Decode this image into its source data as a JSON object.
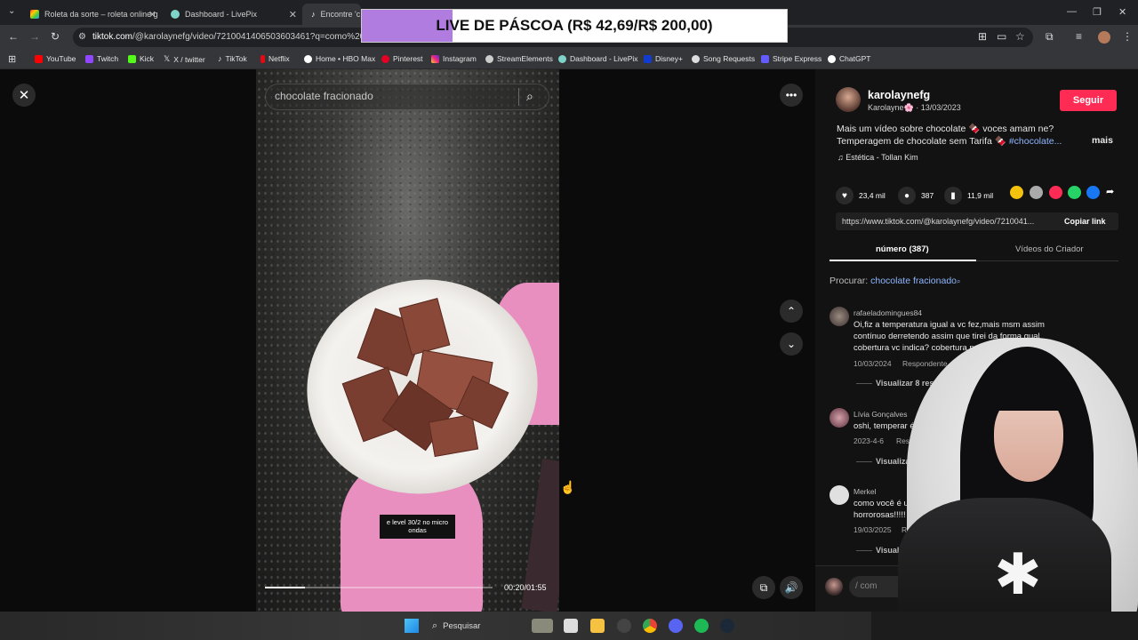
{
  "browser": {
    "tabs": [
      {
        "title": "Roleta da sorte – roleta online g"
      },
      {
        "title": "Dashboard - LivePix"
      },
      {
        "title": "Encontre 'c"
      }
    ],
    "url_domain": "tiktok.com",
    "url_path": "/@karolaynefg/video/7210041406503603461?q=como%20tem",
    "bookmarks": [
      "YouTube",
      "Twitch",
      "Kick",
      "X / twitter",
      "TikTok",
      "Netflix",
      "Home • HBO Max",
      "Pinterest",
      "Instagram",
      "StreamElements",
      "Dashboard - LivePix",
      "Disney+",
      "Song Requests",
      "Stripe Express",
      "ChatGPT"
    ]
  },
  "live_banner": {
    "text": "LIVE DE PÁSCOA (R$ 42,69/R$ 200,00)",
    "progress": 0.2135
  },
  "video": {
    "search_placeholder": "chocolate fracionado",
    "caption": "e level 30/2 no micro ondas",
    "time": "00:20/01:55",
    "progress": 0.174
  },
  "creator": {
    "username": "karolaynefg",
    "subline": "Karolayne🌸 · 13/03/2023",
    "follow_label": "Seguir",
    "desc_line1": "Mais um vídeo sobre chocolate 🍫 voces amam ne?",
    "desc_line2_prefix": "Temperagem de chocolate sem Tarifa 🍫 ",
    "hashtag": "#chocolate...",
    "more_label": "mais",
    "music": "♫  Estética - Tollan Kim"
  },
  "stats": {
    "likes": "23,4 mil",
    "comments": "387",
    "saves": "11,9 mil"
  },
  "link": {
    "url": "https://www.tiktok.com/@karolaynefg/video/7210041...",
    "copy_label": "Copiar link"
  },
  "panel_tabs": [
    "número (387)",
    "Vídeos do Criador"
  ],
  "search_related": {
    "label": "Procurar: ",
    "term": "chocolate fracionado"
  },
  "comments": [
    {
      "user": "rafaeladomingues84",
      "text_line1": "Oi,fiz a temperatura igual a vc fez,mais msm assim",
      "text_line2": "contínuo derretendo assim que tirei da forma,qual",
      "text_line3": "cobertura vc indica? cobertura precisa fazer",
      "date": "10/03/2024",
      "reply": "Respondente",
      "replies": "Visualizar 8 respostas"
    },
    {
      "user": "Lívia Gonçalves",
      "text_line1": "oshi, temperar é só derreter",
      "date": "2023-4-6",
      "reply": "Respondente",
      "replies": "Visualizar 6 respostas"
    },
    {
      "user": "Merkel",
      "text_line1": "como você é uma m",
      "text_line2": "horrorosas!!!!!",
      "date": "19/03/2025",
      "reply": "Resp",
      "replies": "Visuali"
    }
  ],
  "comment_input_placeholder": "/ com",
  "taskbar": {
    "search_label": "Pesquisar"
  },
  "colors": {
    "follow": "#fe2c55",
    "banner_fill": "#b07ce0",
    "link_blue": "#8fb6ff"
  }
}
